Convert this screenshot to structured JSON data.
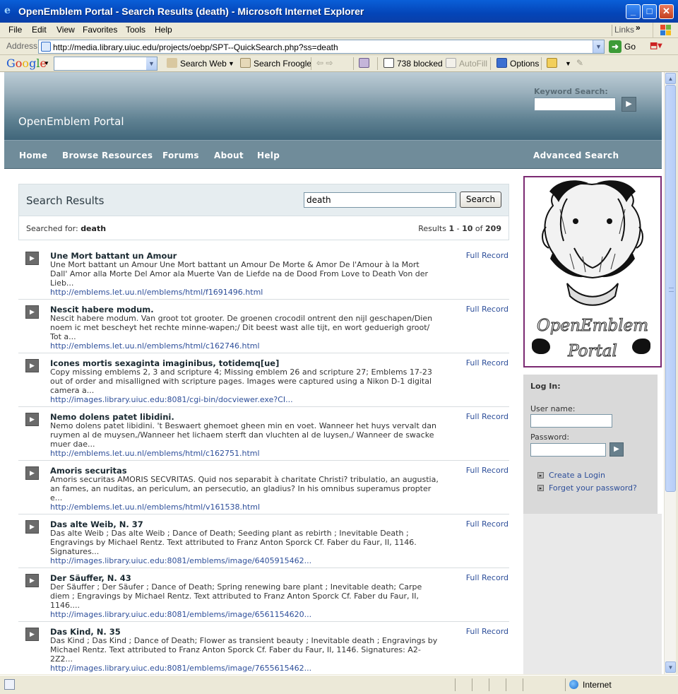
{
  "window": {
    "title": "OpenEmblem Portal - Search Results (death) - Microsoft Internet Explorer"
  },
  "menubar": {
    "items": [
      "File",
      "Edit",
      "View",
      "Favorites",
      "Tools",
      "Help"
    ],
    "links_label": "Links"
  },
  "addressbar": {
    "label": "Address",
    "url": "http://media.library.uiuc.edu/projects/oebp/SPT--QuickSearch.php?ss=death",
    "go_label": "Go"
  },
  "google_toolbar": {
    "logo": "Google",
    "search_value": "",
    "search_web": "Search Web",
    "search_froogle": "Search Froogle",
    "blocked": "738 blocked",
    "autofill": "AutoFill",
    "options": "Options"
  },
  "site": {
    "name": "OpenEmblem Portal",
    "keyword_label": "Keyword Search:",
    "keyword_value": "",
    "nav": [
      "Home",
      "Browse Resources",
      "Forums",
      "About",
      "Help"
    ],
    "advanced_search": "Advanced Search"
  },
  "results": {
    "heading": "Search Results",
    "query_value": "death",
    "search_button": "Search",
    "searched_for_label": "Searched for:",
    "searched_for_term": "death",
    "count_prefix": "Results",
    "range_start": "1",
    "range_sep": "-",
    "range_end": "10",
    "count_of": "of",
    "total": "209",
    "full_record_label": "Full Record",
    "items": [
      {
        "title": "Une Mort battant un Amour",
        "desc": "Une Mort battant un Amour Une Mort battant un Amour De Morte & Amor De l'Amour à la Mort Dall' Amor alla Morte Del Amor ala Muerte Van de Liefde na de Dood From Love to Death Von der Lieb...",
        "url": "http://emblems.let.uu.nl/emblems/html/f1691496.html"
      },
      {
        "title": "Nescit habere modum.",
        "desc": "Nescit habere modum. Van groot tot grooter. De groenen crocodil ontrent den nijl geschapen/Dien noem ic met bescheyt het rechte minne-wapen;/ Dit beest wast alle tijt, en wort geduerigh groot/ Tot a...",
        "url": "http://emblems.let.uu.nl/emblems/html/c162746.html"
      },
      {
        "title": "Icones mortis sexaginta imaginibus, totidemq[ue]",
        "desc": "Copy missing emblems 2, 3 and scripture 4; Missing emblem 26 and scripture 27; Emblems 17-23 out of order and misalligned with scripture pages. Images were captured using a Nikon D-1 digital camera a...",
        "url": "http://images.library.uiuc.edu:8081/cgi-bin/docviewer.exe?CI..."
      },
      {
        "title": "Nemo dolens patet libidini.",
        "desc": "Nemo dolens patet libidini. 't Beswaert ghemoet gheen min en voet. Wanneer het huys vervalt dan ruymen al de muysen,/Wanneer het lichaem sterft dan vluchten al de luysen,/ Wanneer de swacke muer dae...",
        "url": "http://emblems.let.uu.nl/emblems/html/c162751.html"
      },
      {
        "title": "Amoris securitas",
        "desc": "Amoris securitas AMORIS SECVRITAS. Quid nos separabit à charitate Christi? tribulatio, an augustia, an fames, an nuditas, an periculum, an persecutio, an gladius? In his omnibus superamus propter e...",
        "url": "http://emblems.let.uu.nl/emblems/html/v161538.html"
      },
      {
        "title": "Das alte Weib, N. 37",
        "desc": "Das alte Weib ; Das alte Weib ; Dance of Death; Seeding plant as rebirth ; Inevitable Death ; Engravings by Michael Rentz. Text attributed to Franz Anton Sporck Cf. Faber du Faur, II, 1146. Signatures...",
        "url": "http://images.library.uiuc.edu:8081/emblems/image/6405915462..."
      },
      {
        "title": "Der Säuffer, N. 43",
        "desc": "Der Säuffer ; Der Säufer ; Dance of Death; Spring renewing bare plant ; Inevitable death; Carpe diem ; Engravings by Michael Rentz. Text attributed to Franz Anton Sporck Cf. Faber du Faur, II, 1146....",
        "url": "http://images.library.uiuc.edu:8081/emblems/image/6561154620..."
      },
      {
        "title": "Das Kind, N. 35",
        "desc": "Das Kind ; Das Kind ; Dance of Death; Flower as transient beauty ; Inevitable death ; Engravings by Michael Rentz. Text attributed to Franz Anton Sporck Cf. Faber du Faur, II, 1146. Signatures: A2-2Z2...",
        "url": "http://images.library.uiuc.edu:8081/emblems/image/7655615462..."
      }
    ]
  },
  "emblem_logo": {
    "line1": "OpenEmblem",
    "line2": "Portal"
  },
  "login": {
    "title": "Log In:",
    "username_label": "User name:",
    "username_value": "",
    "password_label": "Password:",
    "password_value": "",
    "create_login": "Create a Login",
    "forgot_password": "Forget your password?"
  },
  "statusbar": {
    "text": "",
    "zone": "Internet"
  }
}
